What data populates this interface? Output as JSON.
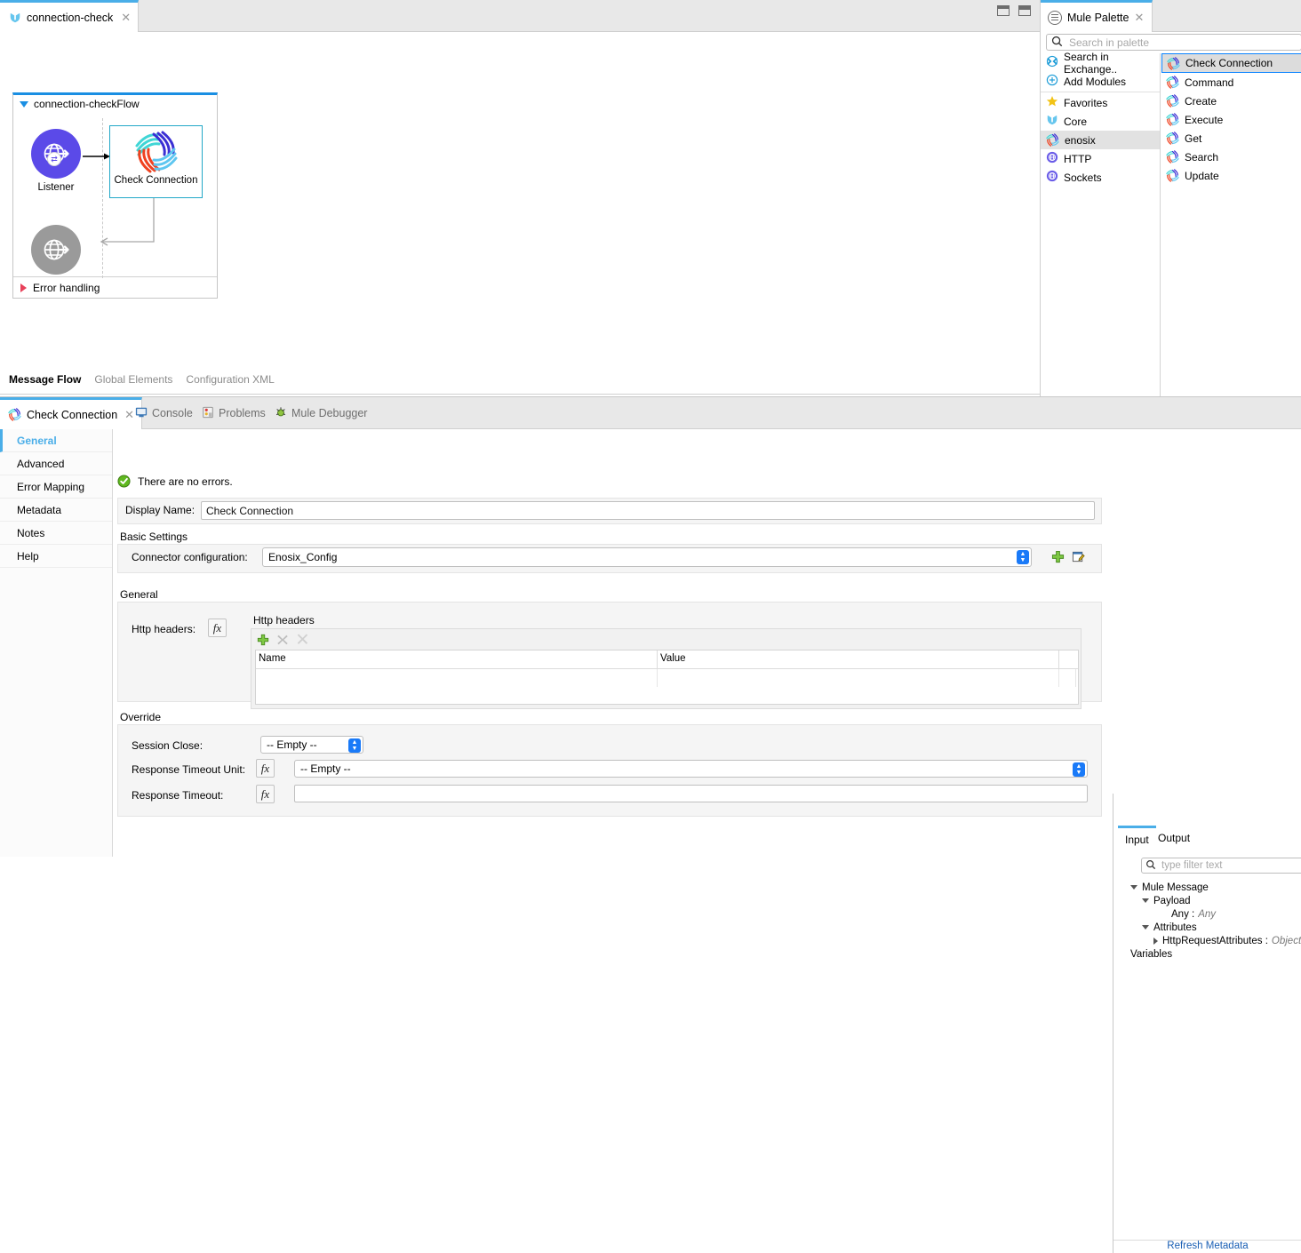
{
  "editor": {
    "tab": {
      "label": "connection-check",
      "close": "✕",
      "icon": "mule-core-icon"
    },
    "view_min": "minimize-view-icon",
    "view_max": "maximize-view-icon",
    "view_tabs": [
      {
        "label": "Message Flow",
        "active": true
      },
      {
        "label": "Global Elements",
        "active": false
      },
      {
        "label": "Configuration XML",
        "active": false
      }
    ]
  },
  "flow": {
    "title": "connection-checkFlow",
    "listener": {
      "label": "Listener",
      "color": "#5b4ae8",
      "icon": "http-listener-icon"
    },
    "processor": {
      "label": "Check Connection",
      "icon": "enosix-icon",
      "selected": true
    },
    "error_node": {
      "color": "#9a9a9a",
      "icon": "http-listener-icon"
    },
    "error_handling": {
      "label": "Error handling"
    }
  },
  "palette": {
    "tab": {
      "label": "Mule Palette",
      "close": "✕",
      "icon": "hamburger-icon"
    },
    "search": {
      "placeholder": "Search in palette",
      "value": ""
    },
    "categories": [
      {
        "label": "Search in Exchange..",
        "icon": "exchange-icon",
        "selected": false
      },
      {
        "label": "Add Modules",
        "icon": "plus-circle-icon",
        "selected": false
      },
      {
        "label": "Favorites",
        "icon": "star-icon",
        "selected": false
      },
      {
        "label": "Core",
        "icon": "mule-core-icon",
        "selected": false
      },
      {
        "label": "enosix",
        "icon": "enosix-icon",
        "selected": true
      },
      {
        "label": "HTTP",
        "icon": "http-icon",
        "selected": false
      },
      {
        "label": "Sockets",
        "icon": "sockets-icon",
        "selected": false
      }
    ],
    "operations": [
      {
        "label": "Check Connection",
        "icon": "enosix-icon",
        "selected": true
      },
      {
        "label": "Command",
        "icon": "enosix-icon",
        "selected": false
      },
      {
        "label": "Create",
        "icon": "enosix-icon",
        "selected": false
      },
      {
        "label": "Execute",
        "icon": "enosix-icon",
        "selected": false
      },
      {
        "label": "Get",
        "icon": "enosix-icon",
        "selected": false
      },
      {
        "label": "Search",
        "icon": "enosix-icon",
        "selected": false
      },
      {
        "label": "Update",
        "icon": "enosix-icon",
        "selected": false
      }
    ]
  },
  "bottom_tabs": {
    "active": {
      "label": "Check Connection",
      "close": "✕",
      "icon": "enosix-icon"
    },
    "others": [
      {
        "label": "Console",
        "icon": "console-icon"
      },
      {
        "label": "Problems",
        "icon": "problems-icon"
      },
      {
        "label": "Mule Debugger",
        "icon": "debugger-icon"
      }
    ]
  },
  "properties": {
    "nav": [
      {
        "label": "General",
        "active": true
      },
      {
        "label": "Advanced",
        "active": false
      },
      {
        "label": "Error Mapping",
        "active": false
      },
      {
        "label": "Metadata",
        "active": false
      },
      {
        "label": "Notes",
        "active": false
      },
      {
        "label": "Help",
        "active": false
      }
    ],
    "status": {
      "text": "There are no errors.",
      "icon": "ok-check-icon"
    },
    "display_name": {
      "label": "Display Name:",
      "value": "Check Connection"
    },
    "basic_settings": {
      "title": "Basic Settings",
      "connector_config": {
        "label": "Connector configuration:",
        "value": "Enosix_Config",
        "add_icon": "plus-icon",
        "edit_icon": "edit-icon"
      }
    },
    "general": {
      "title": "General",
      "http_headers": {
        "label": "Http headers:",
        "fx": "fx",
        "panel_title": "Http headers",
        "toolbar": {
          "add": "add-row-icon",
          "remove": "remove-row-icon",
          "clear": "clear-rows-icon"
        },
        "columns": [
          "Name",
          "Value"
        ],
        "rows": [
          [
            "",
            ""
          ]
        ]
      }
    },
    "override": {
      "title": "Override",
      "session_close": {
        "label": "Session Close:",
        "value": "-- Empty --"
      },
      "response_timeout_unit": {
        "label": "Response Timeout Unit:",
        "fx": "fx",
        "value": "-- Empty --"
      },
      "response_timeout": {
        "label": "Response Timeout:",
        "fx": "fx",
        "value": ""
      }
    }
  },
  "metadata": {
    "tabs": [
      {
        "label": "Input",
        "active": true
      },
      {
        "label": "Output",
        "active": false
      }
    ],
    "search": {
      "placeholder": "type filter text",
      "value": ""
    },
    "tree": [
      {
        "label": "Mule Message",
        "indent": 0,
        "twisty": "down",
        "type": ""
      },
      {
        "label": "Payload",
        "indent": 1,
        "twisty": "down",
        "type": ""
      },
      {
        "label": "Any :",
        "indent": 2,
        "twisty": "none",
        "type": "Any"
      },
      {
        "label": "Attributes",
        "indent": 1,
        "twisty": "down",
        "type": ""
      },
      {
        "label": "HttpRequestAttributes :",
        "indent": 2,
        "twisty": "right",
        "type": "Object"
      },
      {
        "label": "Variables",
        "indent": 1,
        "twisty": "none-flush",
        "type": ""
      }
    ],
    "refresh_link": "Refresh Metadata"
  },
  "colors": {
    "accent": "#4aaee8",
    "selection": "#0a84ff",
    "listener": "#5b4ae8",
    "enosix_red": "#f0411f",
    "enosix_blue": "#3b2fd4",
    "enosix_cyan": "#40d6d6",
    "enosix_lightblue": "#5ec6f0",
    "link": "#1a5fb4"
  }
}
